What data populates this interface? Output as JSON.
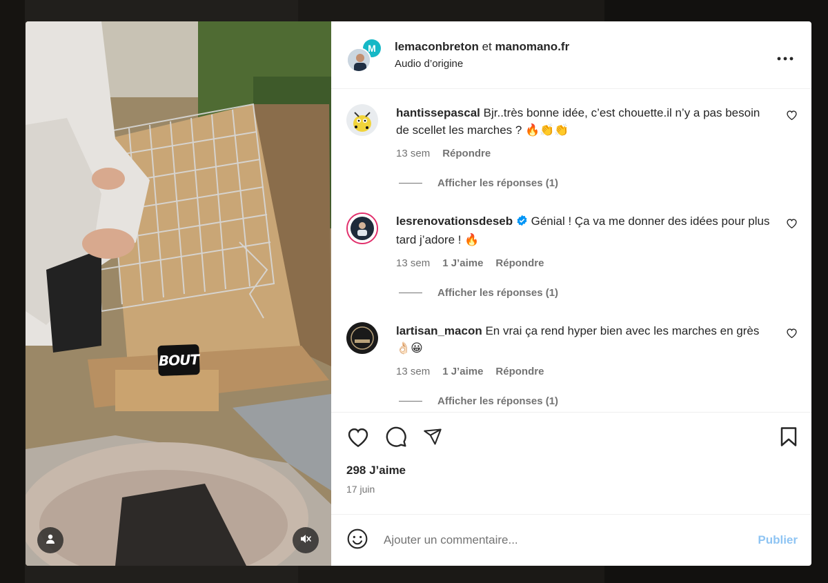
{
  "post": {
    "authors": {
      "user1": "lemaconbreton",
      "joiner": "et",
      "user2": "manomano.fr"
    },
    "audio": "Audio d’origine",
    "sticker": "BOUT"
  },
  "comments": [
    {
      "username": "hantissepascal",
      "text": "Bjr..très bonne idée, c’est chouette.il n’y a pas besoin de scellet les marches ? 🔥👏👏",
      "age": "13 sem",
      "likes": "",
      "reply": "Répondre",
      "replies": "Afficher les réponses (1)"
    },
    {
      "username": "lesrenovationsdeseb",
      "verified": true,
      "text": "Génial ! Ça va me donner des idées pour plus tard j’adore ! 🔥",
      "age": "13 sem",
      "likes": "1 J’aime",
      "reply": "Répondre",
      "replies": "Afficher les réponses (1)"
    },
    {
      "username": "lartisan_macon",
      "text": "En vrai ça rend hyper bien avec les marches en grès 👌🏻😀",
      "age": "13 sem",
      "likes": "1 J’aime",
      "reply": "Répondre",
      "replies": "Afficher les réponses (1)"
    }
  ],
  "stats": {
    "likes": "298 J’aime",
    "date": "17 juin"
  },
  "add_comment": {
    "placeholder": "Ajouter un commentaire...",
    "publish": "Publier"
  },
  "colors": {
    "verified": "#0095f6",
    "publish_disabled": "#8ec4f3",
    "secondary_text": "#737373"
  },
  "icons": [
    "more-icon",
    "heart-icon",
    "comment-icon",
    "share-icon",
    "bookmark-icon",
    "emoji-icon",
    "user-icon",
    "mute-icon",
    "verified-icon"
  ]
}
